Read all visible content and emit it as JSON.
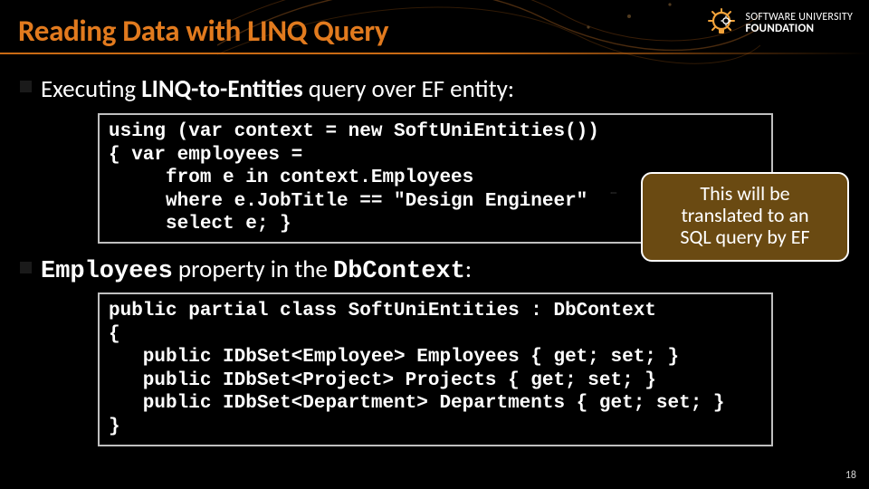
{
  "slide": {
    "title": "Reading Data with LINQ Query",
    "page_number": "18"
  },
  "logo": {
    "line1": "SOFTWARE UNIVERSITY",
    "line2": "FOUNDATION",
    "icon_name": "lightbulb-gear-icon"
  },
  "bullets": {
    "b1_pre": "Executing ",
    "b1_bold": "LINQ-to-Entities",
    "b1_post": " query over EF entity:",
    "b2_bold": "Employees",
    "b2_mid": " property in the ",
    "b2_code": "DbContext",
    "b2_colon": ":"
  },
  "callout": {
    "line1": "This will be",
    "line2": "translated to an",
    "line3": "SQL query by EF"
  },
  "code1": {
    "l1": "using (var context = new SoftUniEntities())",
    "l2": "{ var employees =",
    "l3": "     from e in context.Employees",
    "l4": "     where e.JobTitle == \"Design Engineer\"",
    "l5": "     select e; }"
  },
  "code2": {
    "l1": "public partial class SoftUniEntities : DbContext",
    "l2": "{",
    "l3": "   public IDbSet<Employee> Employees { get; set; }",
    "l4": "   public IDbSet<Project> Projects { get; set; }",
    "l5": "   public IDbSet<Department> Departments { get; set; }",
    "l6": "}"
  }
}
